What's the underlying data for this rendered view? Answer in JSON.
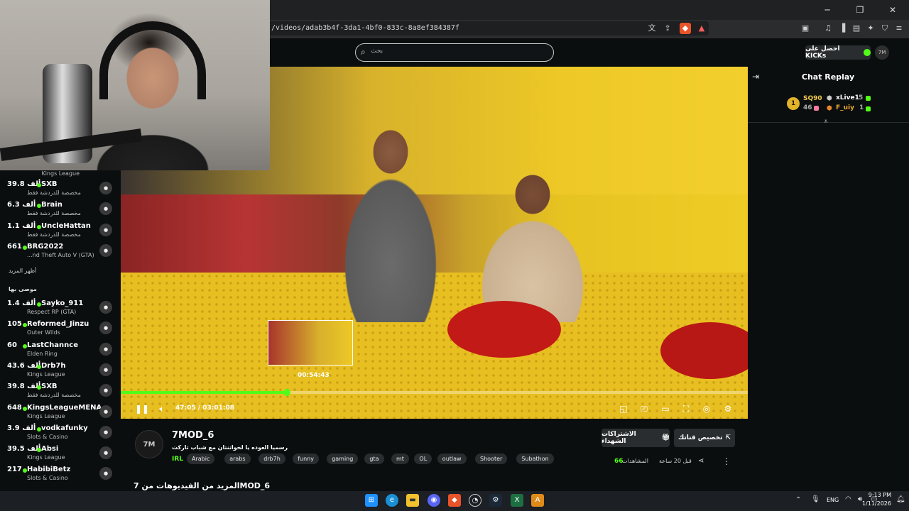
{
  "browser": {
    "url": "/videos/adab3b4f-3da1-4bf0-833c-8a8ef384387f",
    "window_controls": [
      "─",
      "❐",
      "✕"
    ]
  },
  "header": {
    "search_placeholder": "بحث",
    "kicks_label": "احصل على KICKs",
    "avatar_text": "7M"
  },
  "sidebar": {
    "top_cat": "Kings League",
    "items": [
      {
        "count": "39.8 ألف",
        "name": "SXB",
        "cat": "مخصصة للدردشة فقط"
      },
      {
        "count": "6.3 ألف",
        "name": "Brain",
        "cat": "مخصصة للدردشة فقط"
      },
      {
        "count": "1.1 ألف",
        "name": "UncleHattan",
        "cat": "مخصصة للدردشة فقط"
      },
      {
        "count": "661",
        "name": "BRG2022",
        "cat": "...nd Theft Auto V (GTA)"
      }
    ],
    "show_more": "أظهر المزيد",
    "recommended_title": "موصى بها",
    "recommended": [
      {
        "count": "1.4 ألف",
        "name": "Sayko_911",
        "cat": "Respect RP (GTA)"
      },
      {
        "count": "105",
        "name": "Reformed_Jinzu",
        "cat": "Outer Wilds"
      },
      {
        "count": "60",
        "name": "LastChannce",
        "cat": "Elden Ring"
      },
      {
        "count": "43.6 ألف",
        "name": "Drb7h",
        "cat": "Kings League"
      },
      {
        "count": "39.8 ألف",
        "name": "SXB",
        "cat": "مخصصة للدردشة فقط"
      },
      {
        "count": "648",
        "name": "KingsLeagueMENA",
        "cat": "Kings League"
      },
      {
        "count": "3.9 ألف",
        "name": "vodkafunky",
        "cat": "Slots & Casino"
      },
      {
        "count": "39.5 ألف",
        "name": "Absi",
        "cat": "Kings League"
      },
      {
        "count": "217",
        "name": "HabibiBetz",
        "cat": "Slots & Casino"
      }
    ]
  },
  "player": {
    "preview_time": "00:54:43",
    "time": "47:05 / 03:01:08",
    "progress_fraction": 0.265
  },
  "chat": {
    "title": "Chat Replay",
    "leaderboard": [
      {
        "rank": "1",
        "name": "SQ90",
        "value": "46"
      },
      {
        "name": "xLive1",
        "value": "5"
      },
      {
        "name": "F_uiy",
        "value": "1"
      }
    ]
  },
  "info": {
    "channel_name": "7MOD_6",
    "channel_avatar": "7M",
    "title": "رسميا العوده يا لخواتنتان مع شباب ثاركت",
    "category": "IRL",
    "tags": [
      "Arabic",
      "arabs",
      "drb7h",
      "funny",
      "gaming",
      "gta",
      "mt",
      "OL",
      "outlaw",
      "Shooter",
      "Subathon"
    ],
    "subs_button": "الاشتراكات الشهداء",
    "clip_button": "تخصيص قناتك",
    "views_count": "66",
    "views_label": "المشاهدات",
    "posted": "قبل 20 ساعة",
    "more_videos": "المزيد من الفيديوهات من 7MOD_6"
  },
  "taskbar": {
    "lang": "ENG",
    "time": "9:13 PM",
    "date": "1/11/2026"
  },
  "colors": {
    "accent": "#53fc18",
    "background": "#0b0e0f"
  }
}
